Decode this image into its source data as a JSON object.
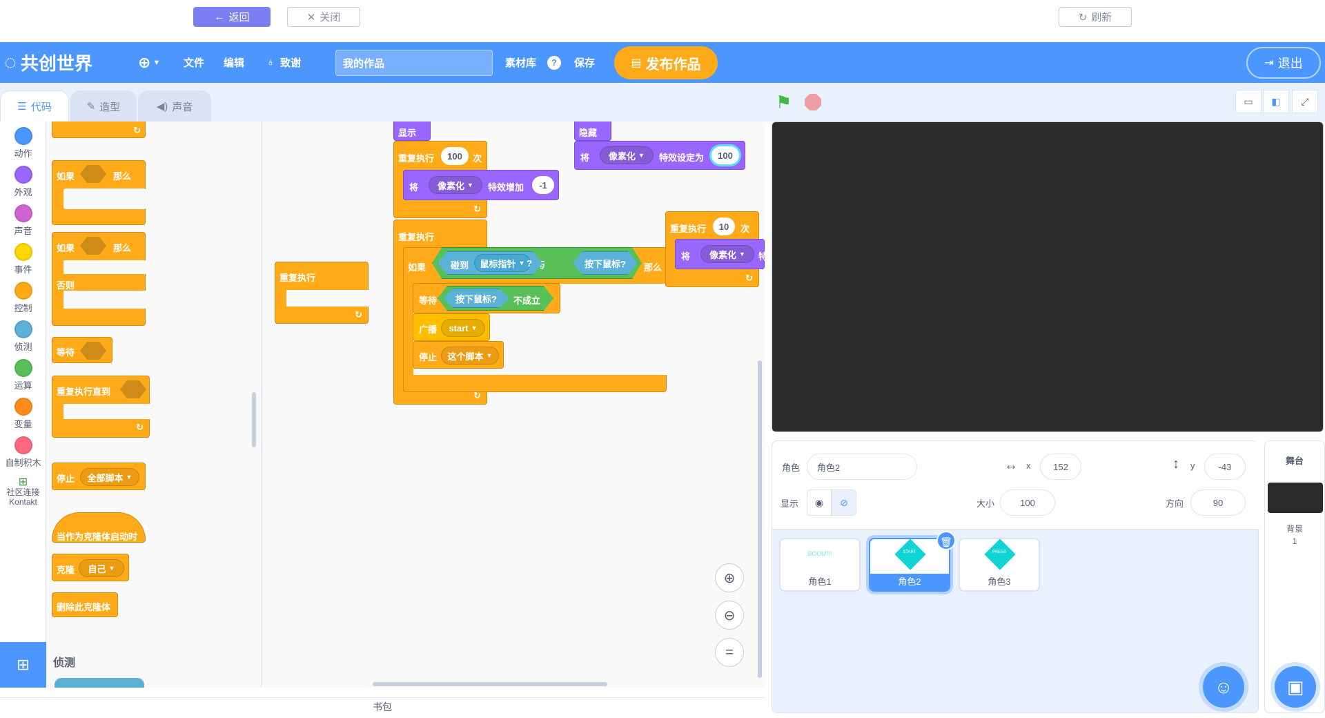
{
  "topbar": {
    "back": "返回",
    "close": "关闭",
    "refresh": "刷新"
  },
  "menu": {
    "logo": "共创世界",
    "file": "文件",
    "edit": "编辑",
    "thanks": "致谢",
    "project_title": "我的作品",
    "assets": "素材库",
    "save": "保存",
    "publish": "发布作品",
    "exit": "退出"
  },
  "tabs": {
    "code": "代码",
    "costumes": "造型",
    "sounds": "声音"
  },
  "categories": [
    {
      "label": "动作",
      "color": "#4c97ff"
    },
    {
      "label": "外观",
      "color": "#9966ff"
    },
    {
      "label": "声音",
      "color": "#cf63cf"
    },
    {
      "label": "事件",
      "color": "#ffd500"
    },
    {
      "label": "控制",
      "color": "#ffab19"
    },
    {
      "label": "侦测",
      "color": "#5cb1d6"
    },
    {
      "label": "运算",
      "color": "#59c059"
    },
    {
      "label": "变量",
      "color": "#ff8c1a"
    },
    {
      "label": "自制积木",
      "color": "#ff6680"
    },
    {
      "label": "社区连接 Kontakt",
      "color": ""
    }
  ],
  "palette": {
    "if_then": "如果",
    "then": "那么",
    "else": "否则",
    "wait": "等待",
    "repeat_until": "重复执行直到",
    "stop": "停止",
    "stop_opt": "全部脚本",
    "clone_start": "当作为克隆体启动时",
    "clone": "克隆",
    "clone_opt": "自己",
    "delete_clone": "删除此克隆体",
    "sensing_header": "侦测"
  },
  "script": {
    "show": "显示",
    "hide": "隐藏",
    "repeat": "重复执行",
    "times": "次",
    "repeat_count_1": "100",
    "repeat_count_2": "10",
    "set": "将",
    "effect": "像素化",
    "change_effect": "特效增加",
    "change_value": "-1",
    "set_effect": "特效设定为",
    "set_value": "100",
    "forever": "重复执行",
    "if": "如果",
    "touching": "碰到",
    "mouse_pointer": "鼠标指针",
    "question": "?",
    "and": "与",
    "mouse_down": "按下鼠标?",
    "then": "那么",
    "wait": "等待",
    "not_true": "不成立",
    "broadcast": "广播",
    "broadcast_msg": "start",
    "stop": "停止",
    "stop_opt": "这个脚本",
    "partial_set": "将",
    "partial_effect": "像素化",
    "partial_tail": "特",
    "loose_forever": "重复执行"
  },
  "backpack": "书包",
  "sprite_info": {
    "sprite_label": "角色",
    "sprite_name": "角色2",
    "x_label": "x",
    "x_value": "152",
    "y_label": "y",
    "y_value": "-43",
    "show_label": "显示",
    "size_label": "大小",
    "size_value": "100",
    "direction_label": "方向",
    "direction_value": "90"
  },
  "sprites": [
    {
      "name": "角色1",
      "thumb": "BOOM!!!"
    },
    {
      "name": "角色2",
      "thumb": "START"
    },
    {
      "name": "角色3",
      "thumb": "PRESS"
    }
  ],
  "stage_panel": {
    "title": "舞台",
    "backdrop_label": "背景",
    "backdrop_count": "1"
  }
}
